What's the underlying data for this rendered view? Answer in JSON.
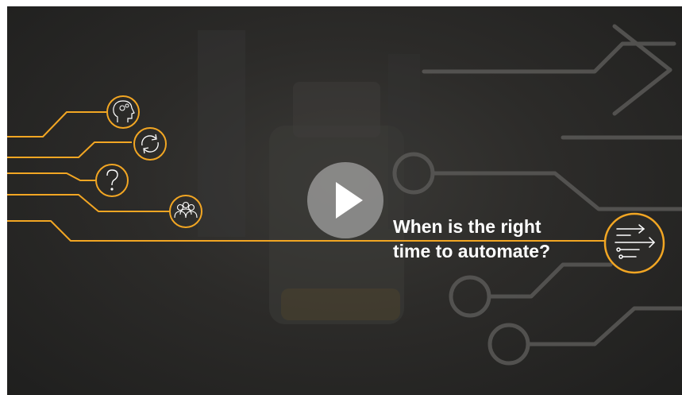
{
  "video": {
    "headline_line1": "When is the right",
    "headline_line2": "time to automate?",
    "play_label": "Play video"
  },
  "icons": [
    "head-gears-icon",
    "cycle-arrows-icon",
    "question-mark-icon",
    "people-group-icon",
    "circuit-arrows-icon"
  ],
  "colors": {
    "accent": "#f2a623",
    "background": "#2a2927",
    "circuit_lines": "#5a5957",
    "headline_text": "#ffffff"
  }
}
